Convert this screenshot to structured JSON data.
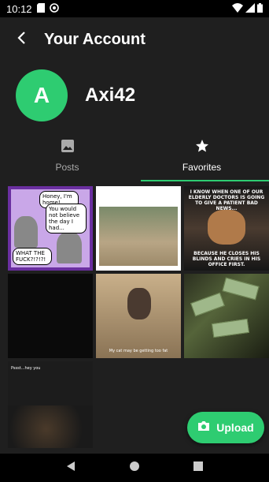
{
  "status_bar": {
    "time": "10:12",
    "icons": [
      "sd-card-icon",
      "at-icon",
      "wifi-icon",
      "signal-icon",
      "battery-icon"
    ]
  },
  "app_bar": {
    "title": "Your Account",
    "back_icon": "arrow-back-icon"
  },
  "profile": {
    "avatar_letter": "A",
    "username": "Axi42",
    "avatar_color": "#2ecc71"
  },
  "tabs": [
    {
      "label": "Posts",
      "icon": "image-icon",
      "active": false
    },
    {
      "label": "Favorites",
      "icon": "star-icon",
      "active": true
    }
  ],
  "accent_color": "#2ecc71",
  "grid": {
    "tile1": {
      "bubble1": "Honey, I'm home!",
      "bubble2": "You would not believe the day I had...",
      "bubble3": "WHAT THE FUCK?!?!?!"
    },
    "tile3": {
      "top_text": "I KNOW WHEN ONE OF OUR ELDERLY DOCTORS IS GOING TO GIVE A PATIENT BAD NEWS...",
      "bottom_text": "BECAUSE HE CLOSES HIS BLINDS AND CRIES IN HIS OFFICE FIRST."
    },
    "tile5": {
      "caption": "My cat may be getting too fat"
    },
    "tile7": {
      "title": "Pssst...hey you"
    }
  },
  "fab": {
    "label": "Upload",
    "icon": "camera-icon"
  },
  "nav": {
    "back": "nav-back-icon",
    "home": "nav-home-icon",
    "recents": "nav-recents-icon"
  }
}
